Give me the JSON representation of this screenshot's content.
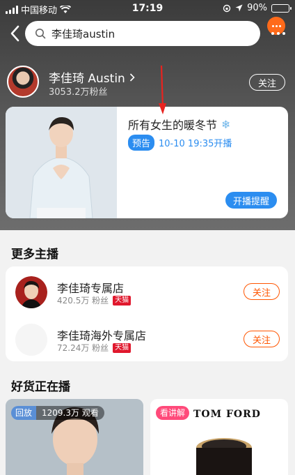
{
  "status_bar": {
    "carrier": "中国移动",
    "time": "17:19",
    "battery": "90%",
    "battery_level": 0.9
  },
  "search": {
    "query": "李佳琦austin"
  },
  "profile": {
    "name": "李佳琦 Austin",
    "fans": "3053.2万粉丝",
    "follow_label": "关注"
  },
  "live_preview": {
    "title": "所有女生的暖冬节",
    "tag": "预告",
    "time": "10-10 19:35开播",
    "remind_label": "开播提醒"
  },
  "more_anchors": {
    "title": "更多主播",
    "items": [
      {
        "name": "李佳琦专属店",
        "fans": "420.5万 粉丝",
        "badge": "天猫",
        "follow_label": "关注"
      },
      {
        "name": "李佳琦海外专属店",
        "fans": "72.24万 粉丝",
        "badge": "天猫",
        "follow_label": "关注"
      }
    ]
  },
  "live_goods": {
    "title": "好货正在播",
    "cards": [
      {
        "tag": "回放",
        "count": "1209.3万 观看",
        "tag_color": "#5a8fd6"
      },
      {
        "tag": "看讲解",
        "brand": "TOM FORD",
        "tag_color": "#ff4a7a"
      }
    ]
  },
  "colors": {
    "accent_blue": "#2b8df0",
    "accent_orange": "#ff5500",
    "tmall_red": "#e0182d"
  }
}
